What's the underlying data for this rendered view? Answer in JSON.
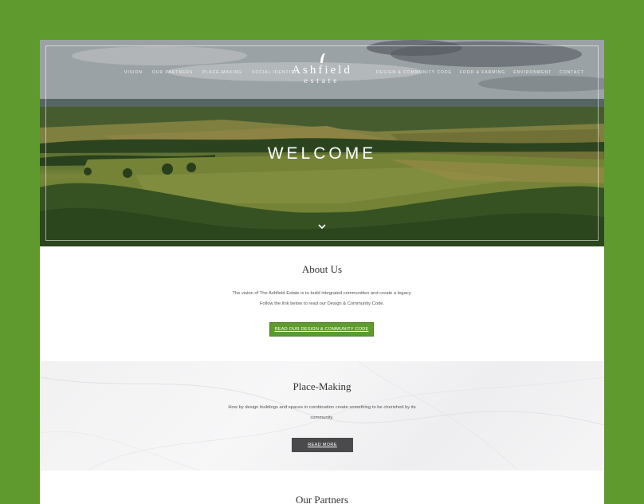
{
  "header": {
    "logo_name": "Ashfield",
    "logo_sub": "estate",
    "nav_left": [
      "VISION",
      "OUR PARTNERS",
      "PLACE-MAKING",
      "SOCIAL IDENTITY"
    ],
    "nav_right": [
      "DESIGN & COMMUNITY CODE",
      "FOOD & FARMING",
      "ENVIRONMENT",
      "CONTACT"
    ]
  },
  "hero": {
    "title": "WELCOME",
    "scroll_icon": "chevron-down-icon"
  },
  "about": {
    "heading": "About Us",
    "body": "The vision of The Ashfield Estate is to build integrated communities and create a legacy. Follow the link below to read our Design & Community Code.",
    "button": "READ OUR DESIGN & COMMUNITY CODE"
  },
  "place_making": {
    "heading": "Place-Making",
    "body": "How by design buildings and spaces in combination create something to be cherished by its community.",
    "button": "READ MORE"
  },
  "partners": {
    "heading": "Our Partners"
  },
  "colors": {
    "background_green": "#5f9a2e",
    "button_green": "#5f9a2e",
    "button_dark": "#4a4a4c"
  }
}
